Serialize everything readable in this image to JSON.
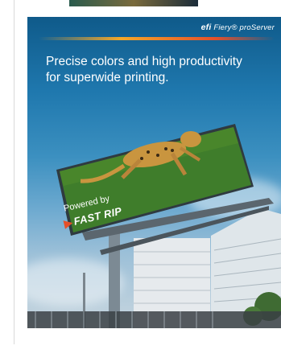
{
  "ad": {
    "brand_prefix": "efi",
    "brand_name": "Fiery® proServer",
    "headline_line1": "Precise colors and high productivity",
    "headline_line2": "for superwide printing.",
    "powered_by": "Powered by",
    "fastrip": "FAST RIP",
    "fastrip_mark": "▶"
  },
  "colors": {
    "sky_top": "#0f5a8a",
    "accent_orange": "#f6a828",
    "accent_red": "#e5502a",
    "grass": "#4f8a2c"
  }
}
